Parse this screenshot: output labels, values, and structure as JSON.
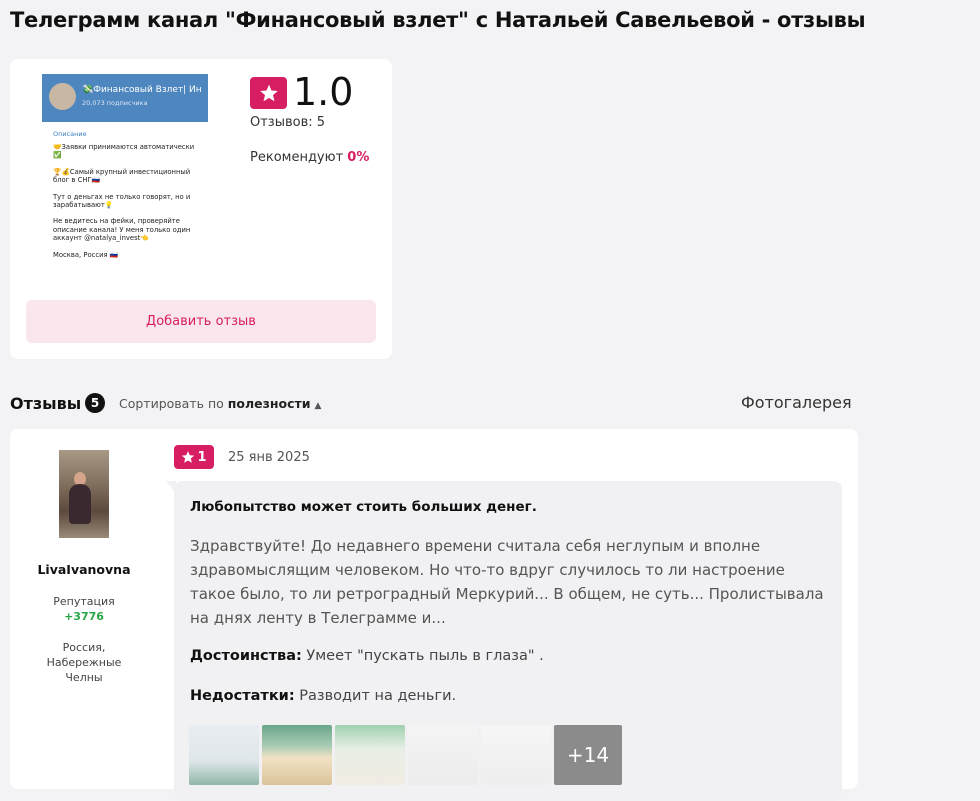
{
  "page": {
    "title": "Телеграмм канал \"Финансовый взлет\" с Натальей Савельевой - отзывы"
  },
  "product": {
    "thumbnail": {
      "channel_name": "💸Финансовый Взлет| Ин",
      "subscribers": "20,073 подписчика",
      "description_label": "Описание",
      "lines": [
        "🤝Заявки принимаются автоматически ✅",
        "",
        "🏆💰Самый крупный инвестиционный блог в СНГ🇷🇺",
        "",
        "Тут о деньгах не только говорят, но и зарабатывают💡",
        "",
        "Не ведитесь на фейки, проверяйте описание канала! У меня только один аккаунт @natalya_invest👈",
        "",
        "Москва, Россия 🇷🇺"
      ]
    },
    "rating": "1.0",
    "reviews_count": "Отзывов: 5",
    "recommend_label": "Рекомендуют",
    "recommend_value": "0%",
    "add_review_label": "Добавить отзыв"
  },
  "reviews_section": {
    "title": "Отзывы",
    "count": "5",
    "sort_label": "Сортировать по",
    "sort_value": "полезности",
    "gallery_label": "Фотогалерея"
  },
  "review": {
    "author": "LivaIvanovna",
    "reputation_label": "Репутация",
    "reputation_value": "+3776",
    "location": "Россия, Набережные Челны",
    "rating": "1",
    "date": "25 янв 2025",
    "title": "Любопытство может стоить больших денег.",
    "text": "Здравствуйте! До недавнего времени считала себя неглупым и вполне здравомыслящим человеком. Но что-то вдруг случилось то ли настроение такое было, то ли ретроградный Меркурий... В общем, не суть... Пролистывала на днях ленту в Телеграмме и...",
    "pros_label": "Достоинства:",
    "pros_value": "Умеет \"пускать пыль в глаза\" .",
    "cons_label": "Недостатки:",
    "cons_value": "Разводит на деньги.",
    "more_photos": "+14"
  },
  "colors": {
    "accent": "#d81e62",
    "reputation": "#28a745"
  }
}
